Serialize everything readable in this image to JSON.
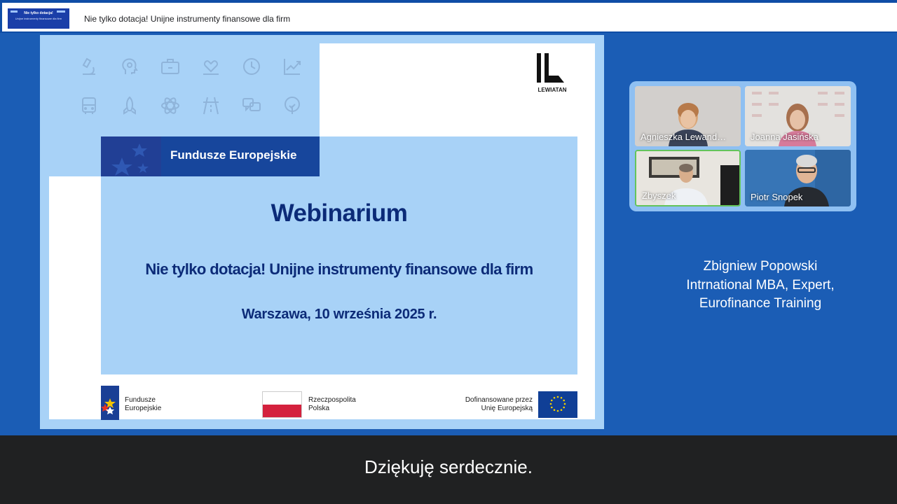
{
  "window": {
    "title": "Nie tylko dotacja! Unijne instrumenty finansowe dla firm",
    "thumbnail": {
      "line1": "Nie tylko dotacja!",
      "line2": "Unijne instrumenty finansowe dla firm"
    }
  },
  "slide": {
    "fundusze_band": "Fundusze Europejskie",
    "heading": "Webinarium",
    "subtitle": "Nie tylko dotacja! Unijne instrumenty finansowe dla firm",
    "date": "Warszawa, 10 września 2025 r.",
    "logo_text": "LEWIATAN",
    "footer": {
      "fe_line1": "Fundusze",
      "fe_line2": "Europejskie",
      "pl_line1": "Rzeczpospolita",
      "pl_line2": "Polska",
      "eu_line1": "Dofinansowane przez",
      "eu_line2": "Unię Europejską"
    },
    "icon_names": [
      "microscope-icon",
      "head-gear-icon",
      "briefcase-icon",
      "heart-hands-icon",
      "clock-icon",
      "chart-up-icon",
      "bus-icon",
      "rocket-icon",
      "atom-icon",
      "road-icon",
      "chat-icon",
      "tree-icon"
    ]
  },
  "participants": [
    {
      "name": "Agnieszka Lewand…"
    },
    {
      "name": "Joanna Jasińska"
    },
    {
      "name": "Zbyszek"
    },
    {
      "name": "Piotr Snopek"
    }
  ],
  "presenter": {
    "line1": "Zbigniew Popowski",
    "line2": "Intrnational MBA, Expert,",
    "line3": "Eurofinance Training"
  },
  "caption": "Dziękuję serdecznie.",
  "colors": {
    "background": "#1b5db5",
    "slide_light_blue": "#a8d2f7",
    "slide_text": "#0c2b78",
    "fe_band": "#17469c",
    "caption_bg": "#202122",
    "active_speaker_border": "#64c45b"
  }
}
